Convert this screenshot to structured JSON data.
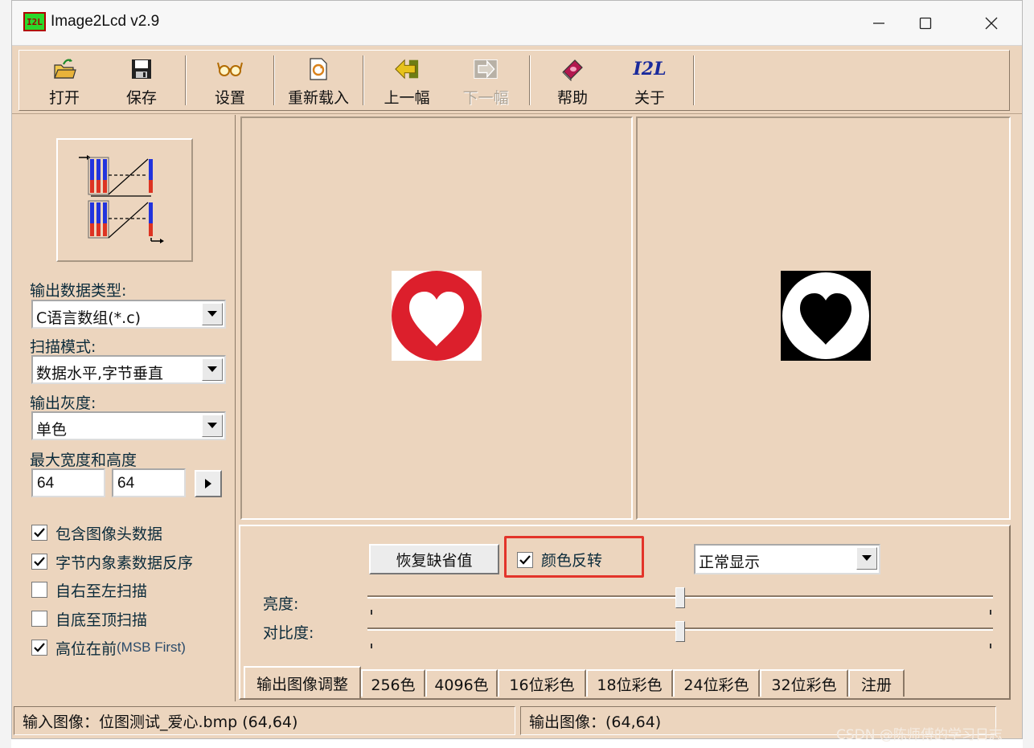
{
  "window": {
    "app_icon_text": "I2L",
    "title": "Image2Lcd v2.9"
  },
  "toolbar": {
    "open": "打开",
    "save": "保存",
    "settings": "设置",
    "reload": "重新载入",
    "prev": "上一幅",
    "next": "下一幅",
    "help": "帮助",
    "about": "关于",
    "about_icon_text": "I2L"
  },
  "left_panel": {
    "output_type_label": "输出数据类型:",
    "output_type_value": "C语言数组(*.c)",
    "scan_mode_label": "扫描模式:",
    "scan_mode_value": "数据水平,字节垂直",
    "gray_label": "输出灰度:",
    "gray_value": "单色",
    "max_size_label": "最大宽度和高度",
    "max_width": "64",
    "max_height": "64",
    "options": [
      {
        "label": "包含图像头数据",
        "checked": true
      },
      {
        "label": "字节内象素数据反序",
        "checked": true
      },
      {
        "label": "自右至左扫描",
        "checked": false
      },
      {
        "label": "自底至顶扫描",
        "checked": false
      },
      {
        "label": "高位在前",
        "label_suffix": "(MSB First)",
        "checked": true
      }
    ]
  },
  "adjust": {
    "restore_button": "恢复缺省值",
    "invert_label": "颜色反转",
    "invert_checked": true,
    "display_mode": "正常显示",
    "brightness_label": "亮度:",
    "brightness_level": 0.5,
    "contrast_label": "对比度:",
    "contrast_level": 0.5,
    "highlight_color": "#e3342a"
  },
  "tabs": [
    "输出图像调整",
    "256色",
    "4096色",
    "16位彩色",
    "18位彩色",
    "24位彩色",
    "32位彩色",
    "注册"
  ],
  "status": {
    "input": "输入图像：位图测试_爱心.bmp (64,64)",
    "output": "输出图像：(64,64)"
  },
  "watermark": "CSDN @陈师傅的学习日志",
  "colors": {
    "panel_bg": "#ecd5be",
    "heart_red": "#dc1f2c"
  }
}
